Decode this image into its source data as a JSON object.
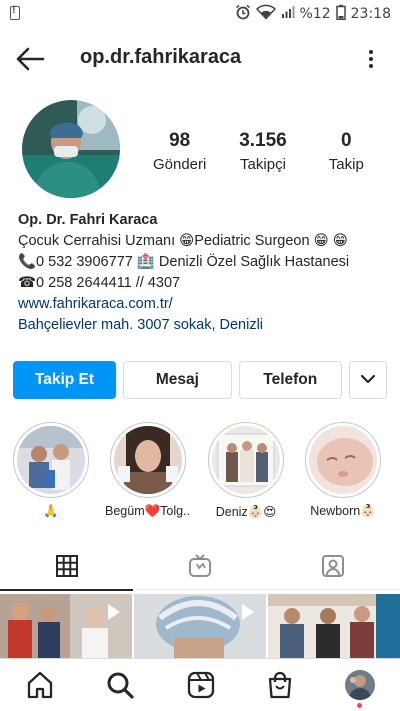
{
  "status_bar": {
    "battery": "%12",
    "time": "23:18"
  },
  "header": {
    "username": "op.dr.fahrikaraca"
  },
  "profile": {
    "posts_count": "98",
    "posts_label": "Gönderi",
    "followers_count": "3.156",
    "followers_label": "Takipçi",
    "following_count": "0",
    "following_label": "Takip"
  },
  "bio": {
    "name": "Op. Dr. Fahri Karaca",
    "line1": "Çocuk Cerrahisi Uzmanı 😁Pediatric Surgeon 😁 😁",
    "line2": "📞0 532 3906777 🏥 Denizli Özel Sağlık Hastanesi",
    "line3": "☎0 258 2644411 // 4307",
    "website": "www.fahrikaraca.com.tr/",
    "address": "Bahçelievler mah. 3007 sokak, Denizli"
  },
  "actions": {
    "follow": "Takip Et",
    "message": "Mesaj",
    "phone": "Telefon"
  },
  "highlights": [
    {
      "label": "🙏"
    },
    {
      "label": "Begüm❤️Tolg..."
    },
    {
      "label": "Deniz👶🏻😍"
    },
    {
      "label": "Newborn👶🏻"
    }
  ],
  "icons": {
    "back": "arrow-left-icon",
    "more": "more-vertical-icon",
    "grid": "grid-icon",
    "igtv": "igtv-icon",
    "tagged": "tagged-icon",
    "home": "home-icon",
    "search": "search-icon",
    "reels": "reels-icon",
    "shop": "shop-icon"
  },
  "colors": {
    "accent": "#0095f6",
    "link": "#00376b",
    "notification": "#ed4956"
  }
}
